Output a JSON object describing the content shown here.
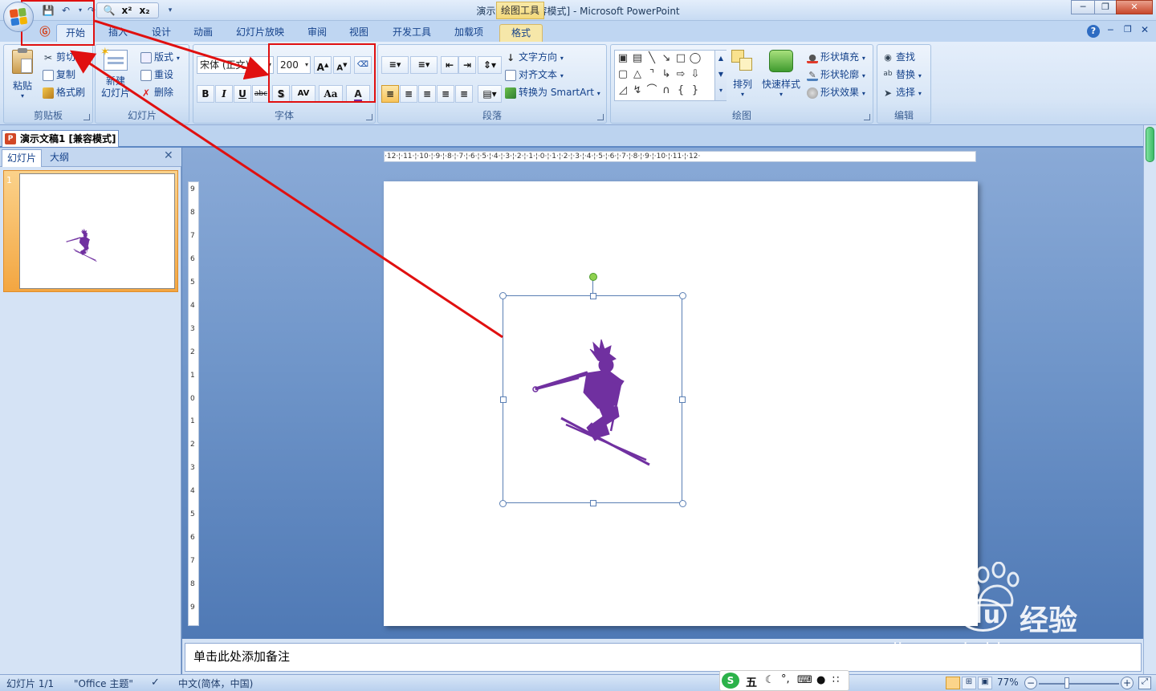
{
  "window": {
    "title": "演示文稿1 [兼容模式] - Microsoft PowerPoint",
    "tool_tab": "绘图工具"
  },
  "tabs": [
    "开始",
    "插入",
    "设计",
    "动画",
    "幻灯片放映",
    "审阅",
    "视图",
    "开发工具",
    "加载项",
    "格式"
  ],
  "active_tab": "开始",
  "ribbon": {
    "clipboard": {
      "label": "剪贴板",
      "paste": "粘贴",
      "cut": "剪切",
      "copy": "复制",
      "format_painter": "格式刷"
    },
    "slides": {
      "label": "幻灯片",
      "new_slide_1": "新建",
      "new_slide_2": "幻灯片",
      "layout": "版式",
      "reset": "重设",
      "delete": "删除"
    },
    "font": {
      "label": "字体",
      "font_name": "宋体 (正文)",
      "font_size": "200",
      "bold": "B",
      "italic": "I",
      "underline": "U",
      "strike": "abc",
      "shadow": "S",
      "spacing": "AV",
      "case": "Aa",
      "font_color": "A",
      "grow": "A",
      "shrink": "A"
    },
    "paragraph": {
      "label": "段落",
      "text_direction": "文字方向",
      "align_text": "对齐文本",
      "smartart": "转换为 SmartArt"
    },
    "drawing": {
      "label": "绘图",
      "arrange": "排列",
      "quick_styles": "快速样式",
      "shape_fill": "形状填充",
      "shape_outline": "形状轮廓",
      "shape_effects": "形状效果"
    },
    "editing": {
      "label": "编辑",
      "find": "查找",
      "replace": "替换",
      "select": "选择"
    }
  },
  "document_tab": "演示文稿1 [兼容模式]",
  "pane_tabs": [
    "幻灯片",
    "大纲"
  ],
  "slide_number": "1",
  "ruler": {
    "horizontal": "·12·¦·11·¦·10·¦·9·¦·8·¦·7·¦·6·¦·5·¦·4·¦·3·¦·2·¦·1·¦·0·¦·1·¦·2·¦·3·¦·4·¦·5·¦·6·¦·7·¦·8·¦·9·¦·10·¦·11·¦·12·",
    "vertical": [
      "9",
      "8",
      "7",
      "6",
      "5",
      "4",
      "3",
      "2",
      "1",
      "0",
      "1",
      "2",
      "3",
      "4",
      "5",
      "6",
      "7",
      "8",
      "9"
    ]
  },
  "notes_placeholder": "单击此处添加备注",
  "status": {
    "slide_count": "幻灯片 1/1",
    "theme": "\"Office 主题\"",
    "language": "中文(简体，中国)",
    "zoom": "77%",
    "ime": "五"
  },
  "watermark": {
    "brand": "Bai",
    "brand2": "du",
    "site_cn": "经验",
    "url": "jingyan.baidu.com"
  },
  "colors": {
    "accent": "#15428b",
    "annotation_red": "#e01010",
    "skier": "#7030a0"
  }
}
